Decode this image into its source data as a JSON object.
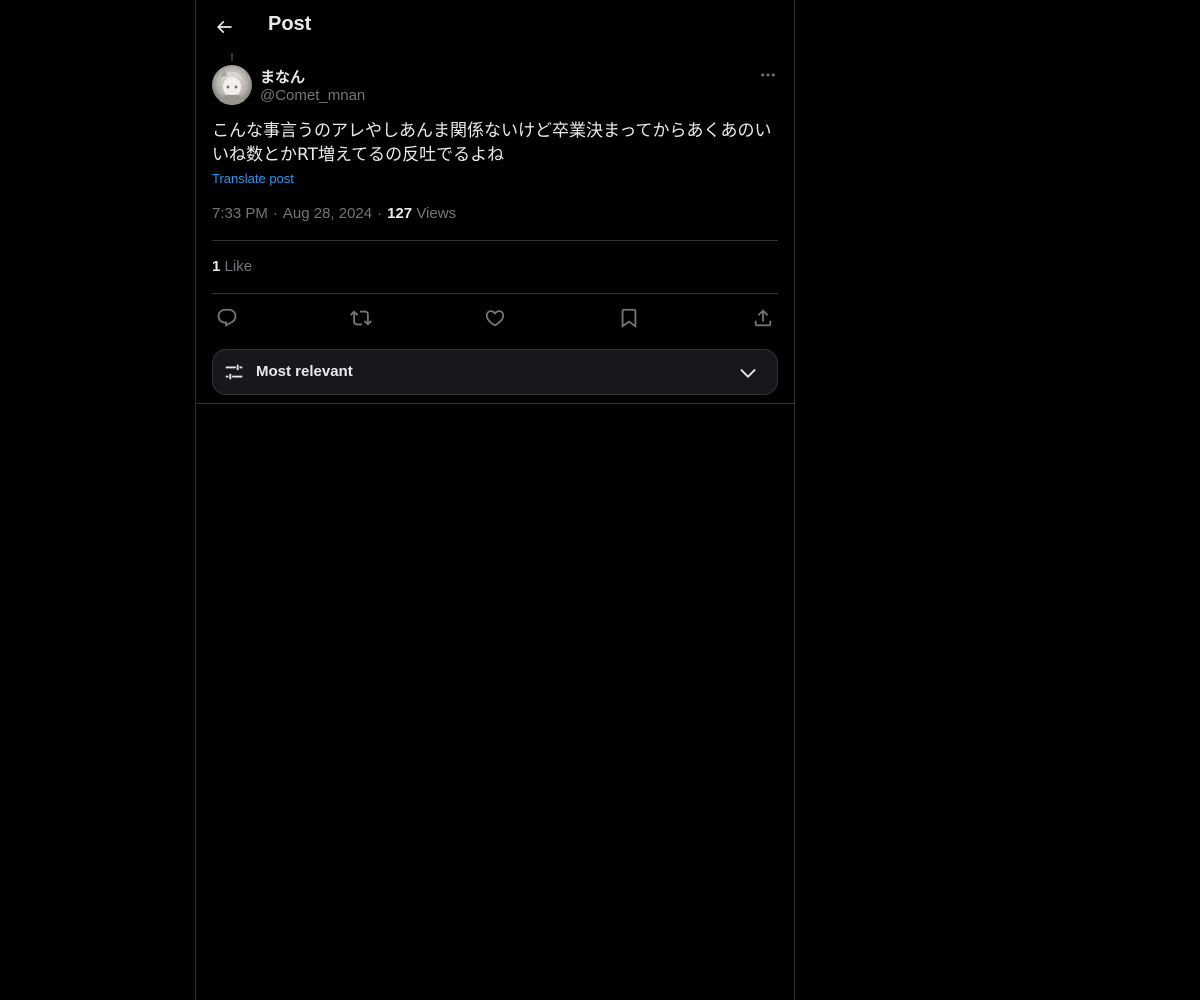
{
  "header": {
    "title": "Post",
    "back_icon": "arrow-left-icon"
  },
  "post": {
    "author": {
      "display_name": "まなん",
      "handle": "@Comet_mnan"
    },
    "text": "こんな事言うのアレやしあんま関係ないけど卒業決まってからあくあのいいね数とかRT増えてるの反吐でるよね",
    "translate_label": "Translate post",
    "time": "7:33 PM",
    "date": "Aug 28, 2024",
    "views_count": "127",
    "views_label": "Views",
    "likes_count": "1",
    "likes_label": "Like"
  },
  "actions": {
    "reply_icon": "reply-icon",
    "retweet_icon": "retweet-icon",
    "like_icon": "heart-icon",
    "bookmark_icon": "bookmark-icon",
    "share_icon": "share-icon"
  },
  "sort": {
    "label": "Most relevant"
  },
  "colors": {
    "background": "#000000",
    "text": "#e7e9ea",
    "secondary_text": "#71767b",
    "link": "#1d9bf0",
    "border": "#2f3336"
  }
}
